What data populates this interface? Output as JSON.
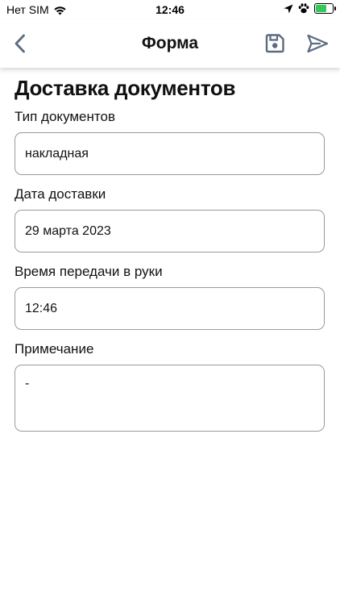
{
  "status_bar": {
    "carrier": "Нет SIM",
    "time": "12:46",
    "icons": [
      "wifi-icon",
      "location-arrow-icon",
      "paw-icon",
      "battery-charging-icon"
    ],
    "battery_level": 0.7
  },
  "header": {
    "title": "Форма",
    "back_icon": "chevron-left-icon",
    "save_icon": "floppy-disk-icon",
    "send_icon": "send-icon",
    "icon_color": "#5b6b80"
  },
  "form": {
    "title": "Доставка документов",
    "fields": [
      {
        "label": "Тип документов",
        "value": "накладная"
      },
      {
        "label": "Дата доставки",
        "value": "29 марта 2023"
      },
      {
        "label": "Время передачи в руки",
        "value": "12:46"
      },
      {
        "label": "Примечание",
        "value": "-"
      }
    ]
  },
  "colors": {
    "battery": "#34c759",
    "border": "#9a9a9a",
    "text": "#111111"
  }
}
